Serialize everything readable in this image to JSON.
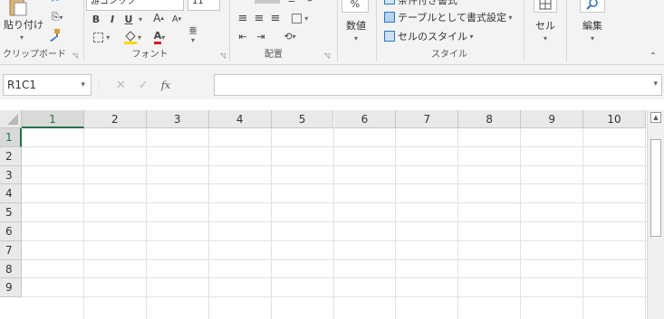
{
  "ribbon": {
    "clipboard": {
      "label": "クリップボード",
      "paste_label": "貼り付け",
      "launcher_icon": "dialog-launcher-icon"
    },
    "font": {
      "label": "フォント",
      "font_name": "游ゴシック",
      "font_size": "11",
      "bold": "B",
      "italic": "I",
      "underline": "U",
      "increase_font": "A",
      "decrease_font": "A",
      "font_color_letter": "A",
      "font_color": "#e81123",
      "fill_color": "#ffd800",
      "phonetic": "亜"
    },
    "alignment": {
      "label": "配置"
    },
    "number": {
      "label": "数値",
      "percent": "%"
    },
    "styles": {
      "label": "スタイル",
      "conditional_formatting": "条件付き書式",
      "format_as_table": "テーブルとして書式設定",
      "cell_styles": "セルのスタイル"
    },
    "cells": {
      "label": "セル"
    },
    "editing": {
      "label": "編集"
    }
  },
  "formula_bar": {
    "name_box": "R1C1",
    "function_label": "fx",
    "formula": ""
  },
  "grid": {
    "columns": [
      "1",
      "2",
      "3",
      "4",
      "5",
      "6",
      "7",
      "8",
      "9",
      "10"
    ],
    "rows": [
      "1",
      "2",
      "3",
      "4",
      "5",
      "6",
      "7",
      "8",
      "9"
    ],
    "selected_column": "1",
    "selected_row": "1",
    "accent_color": "#217346"
  }
}
